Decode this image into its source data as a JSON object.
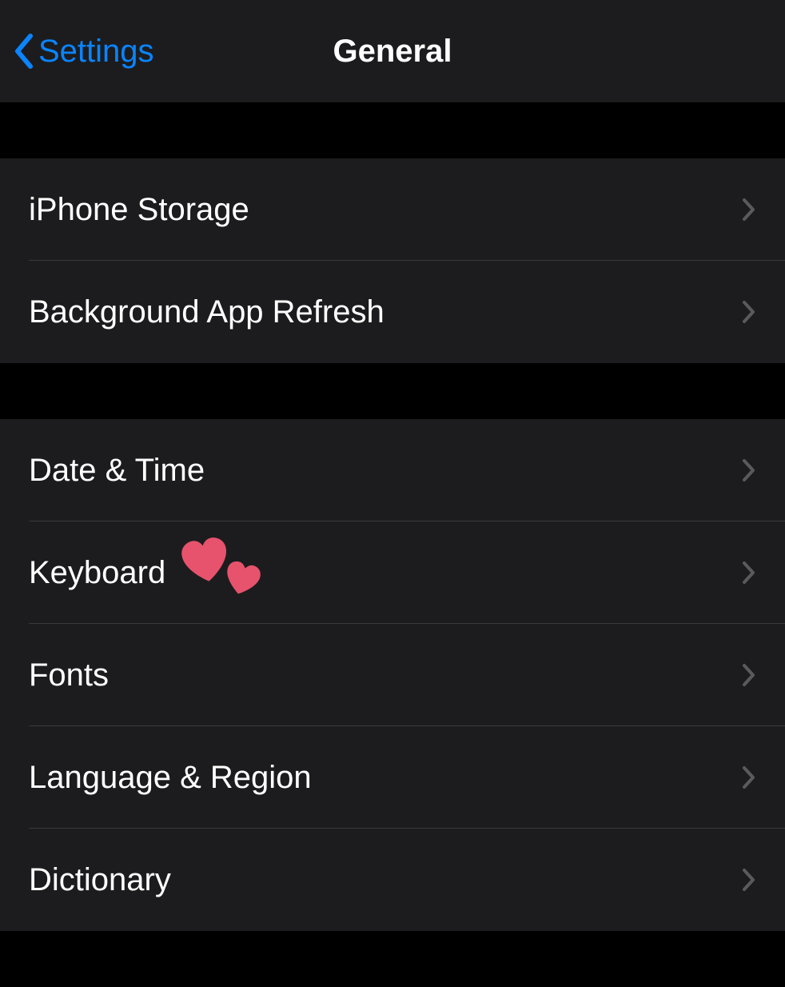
{
  "navbar": {
    "back_label": "Settings",
    "title": "General"
  },
  "groups": [
    {
      "items": [
        {
          "label": "iPhone Storage",
          "decoration": null
        },
        {
          "label": "Background App Refresh",
          "decoration": null
        }
      ]
    },
    {
      "items": [
        {
          "label": "Date & Time",
          "decoration": null
        },
        {
          "label": "Keyboard",
          "decoration": "hearts"
        },
        {
          "label": "Fonts",
          "decoration": null
        },
        {
          "label": "Language & Region",
          "decoration": null
        },
        {
          "label": "Dictionary",
          "decoration": null
        }
      ]
    }
  ],
  "colors": {
    "accent": "#0a84ff",
    "row_bg": "#1c1c1e",
    "heart_fill": "#e7526c"
  }
}
